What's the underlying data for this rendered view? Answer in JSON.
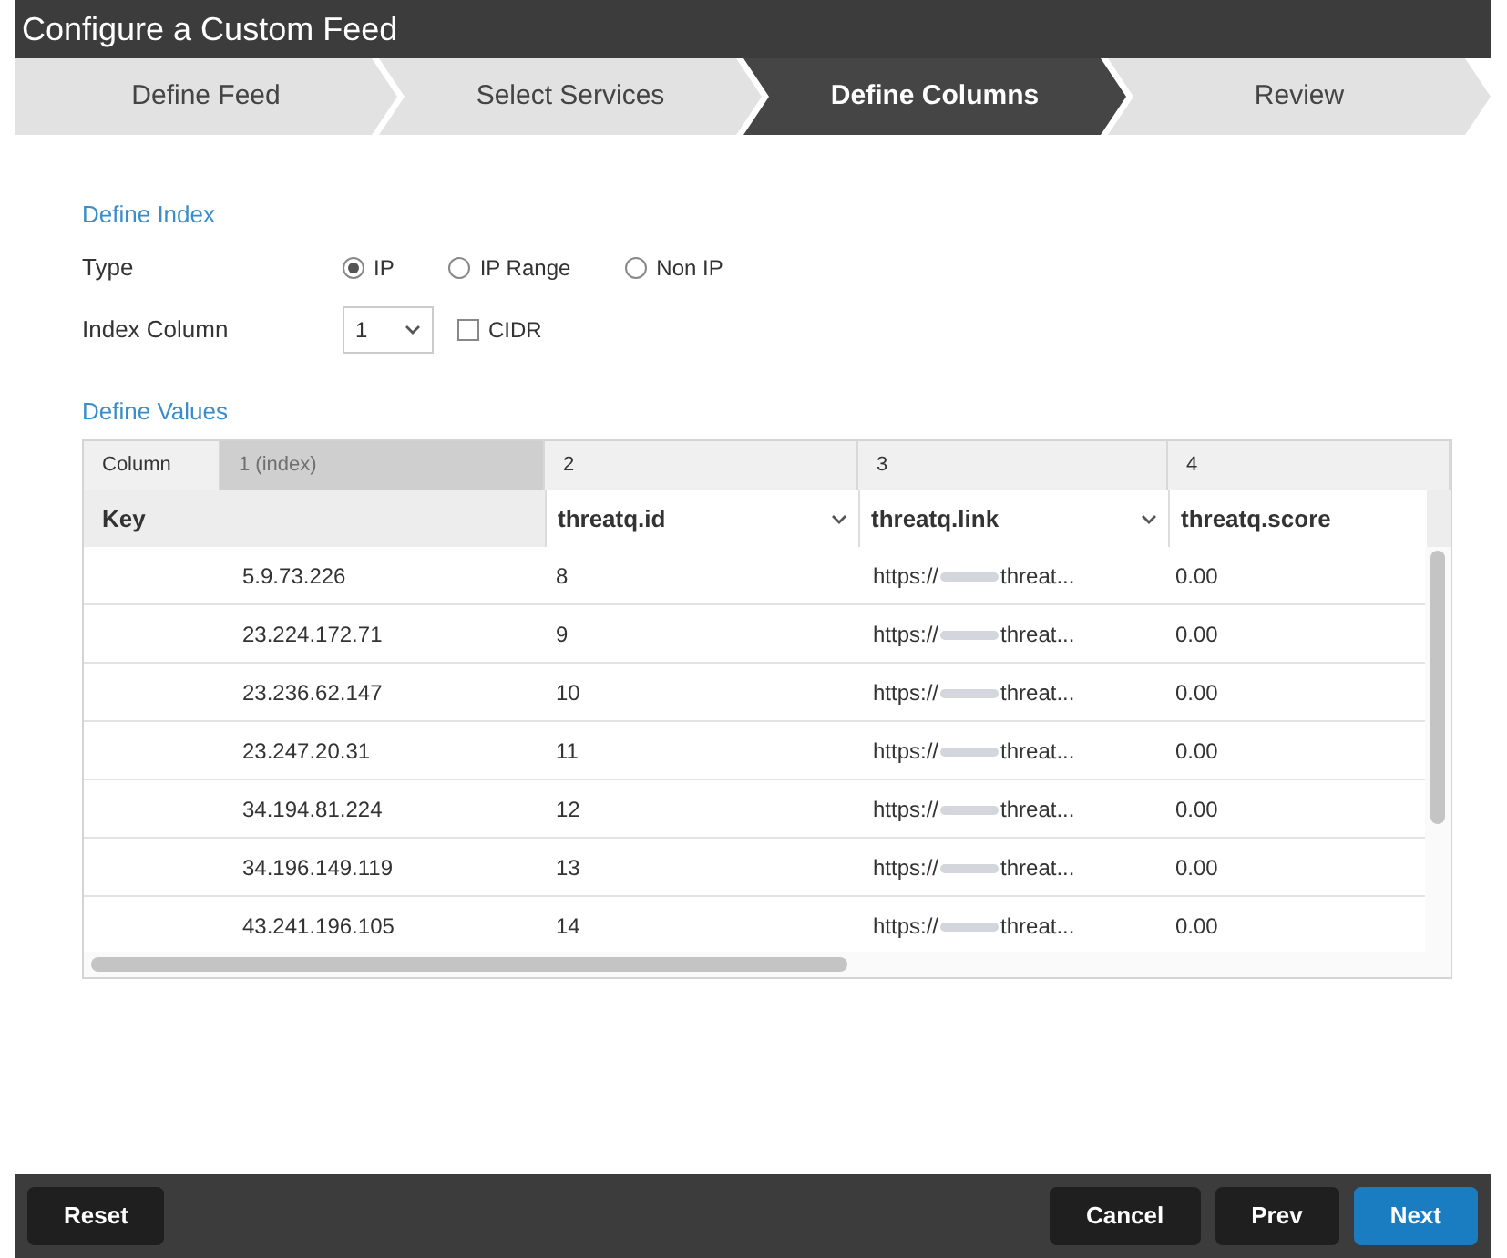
{
  "window": {
    "title": "Configure a Custom Feed"
  },
  "tabs": [
    {
      "label": "Define Feed",
      "selected": false
    },
    {
      "label": "Select Services",
      "selected": false
    },
    {
      "label": "Define Columns",
      "selected": true
    },
    {
      "label": "Review",
      "selected": false
    }
  ],
  "define_index": {
    "heading": "Define Index",
    "type_label": "Type",
    "types": [
      {
        "label": "IP",
        "selected": true
      },
      {
        "label": "IP Range",
        "selected": false
      },
      {
        "label": "Non IP",
        "selected": false
      }
    ],
    "index_column_label": "Index Column",
    "index_column_value": "1",
    "cidr": {
      "label": "CIDR",
      "checked": false
    }
  },
  "define_values": {
    "heading": "Define Values",
    "column_row": [
      {
        "text": "Column",
        "disabled": false
      },
      {
        "text": "1 (index)",
        "disabled": true
      },
      {
        "text": "2",
        "disabled": false
      },
      {
        "text": "3",
        "disabled": false
      },
      {
        "text": "4",
        "disabled": false
      }
    ],
    "key_label": "Key",
    "mappings": [
      {
        "text": "threatq.id",
        "dropdown": true
      },
      {
        "text": "threatq.link",
        "dropdown": true
      },
      {
        "text": "threatq.score",
        "dropdown": false
      }
    ],
    "rows": [
      {
        "key": "5.9.73.226",
        "id": "8",
        "link_prefix": "https://",
        "link_suffix": "threat...",
        "score": "0.00"
      },
      {
        "key": "23.224.172.71",
        "id": "9",
        "link_prefix": "https://",
        "link_suffix": "threat...",
        "score": "0.00"
      },
      {
        "key": "23.236.62.147",
        "id": "10",
        "link_prefix": "https://",
        "link_suffix": "threat...",
        "score": "0.00"
      },
      {
        "key": "23.247.20.31",
        "id": "11",
        "link_prefix": "https://",
        "link_suffix": "threat...",
        "score": "0.00"
      },
      {
        "key": "34.194.81.224",
        "id": "12",
        "link_prefix": "https://",
        "link_suffix": "threat...",
        "score": "0.00"
      },
      {
        "key": "34.196.149.119",
        "id": "13",
        "link_prefix": "https://",
        "link_suffix": "threat...",
        "score": "0.00"
      },
      {
        "key": "43.241.196.105",
        "id": "14",
        "link_prefix": "https://",
        "link_suffix": "threat...",
        "score": "0.00"
      }
    ]
  },
  "footer": {
    "left_buttons": [
      {
        "label": "Reset",
        "kind": "dark"
      }
    ],
    "right_buttons": [
      {
        "label": "Cancel",
        "kind": "dark"
      },
      {
        "label": "Prev",
        "kind": "dark"
      },
      {
        "label": "Next",
        "kind": "primary"
      }
    ]
  }
}
